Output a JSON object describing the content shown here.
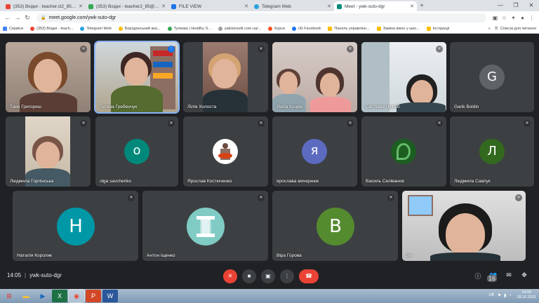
{
  "browser": {
    "tabs": [
      {
        "title": "(353) Вхідні - teacher.cl2_85@ukr",
        "favicon_color": "#4285f4"
      },
      {
        "title": "(353) Вхідні - teacher2_85@ukr",
        "favicon_color": "#34a853"
      },
      {
        "title": "FILE VIEW",
        "favicon_color": "#1a73e8"
      },
      {
        "title": "Telegram Web",
        "favicon_color": "#2aa3e0"
      },
      {
        "title": "Meet - ywk-suto-dgr",
        "favicon_color": "#00897b"
      }
    ],
    "url": "meet.google.com/ywk-suto-dgr",
    "bookmarks": [
      {
        "label": "Сервіси",
        "color": "#4285f4"
      },
      {
        "label": "(353) Вхідні - teach...",
        "color": "#ea4335"
      },
      {
        "label": "Telegram Web",
        "color": "#2aa3e0"
      },
      {
        "label": "Бородянський ака...",
        "color": "#fbbc05"
      },
      {
        "label": "Тулкова | Healthy S...",
        "color": "#34a853"
      },
      {
        "label": "yakistosviti.com.ua/...",
        "color": "#9e9e9e"
      },
      {
        "label": "Курси",
        "color": "#f4511e"
      },
      {
        "label": "(4) Facebook",
        "color": "#1877f2"
      },
      {
        "label": "Панель управлінн...",
        "color": "#fbbc05"
      },
      {
        "label": "Заміна вікон у шко...",
        "color": "#fbbc05"
      },
      {
        "label": "Інструкції",
        "color": "#fbbc05"
      }
    ],
    "reading_list": "Список для читання"
  },
  "participants": [
    {
      "name": "Таня Григориш",
      "type": "video"
    },
    {
      "name": "Тетяна Гребенчук",
      "type": "video"
    },
    {
      "name": "Лілія Холоста",
      "type": "video"
    },
    {
      "name": "Люба Коцюк",
      "type": "video"
    },
    {
      "name": "Світлана Чухліб",
      "type": "video"
    },
    {
      "name": "Garik Boldin",
      "type": "avatar",
      "initial": "G",
      "color": "#5f6368"
    },
    {
      "name": "Людмила Горпінська",
      "type": "video"
    },
    {
      "name": "olga savchenko",
      "type": "avatar",
      "initial": "o",
      "color": "#00897b"
    },
    {
      "name": "Ярослав Костюченко",
      "type": "image"
    },
    {
      "name": "ярослава мочернюк",
      "type": "avatar",
      "initial": "я",
      "color": "#5c6bc0"
    },
    {
      "name": "Василь Селіванов",
      "type": "image"
    },
    {
      "name": "Людмила Савлук",
      "type": "avatar",
      "initial": "Л",
      "color": "#33691e"
    },
    {
      "name": "Наталія Королик",
      "type": "avatar",
      "initial": "H",
      "color": "#0097a7"
    },
    {
      "name": "Антон Іщенко",
      "type": "image"
    },
    {
      "name": "Віра Горова",
      "type": "avatar",
      "initial": "B",
      "color": "#558b2f"
    },
    {
      "name": "Ви",
      "type": "video"
    }
  ],
  "meeting": {
    "time": "14:05",
    "separator": "|",
    "code": "ywk-suto-dgr",
    "participant_count": "16"
  },
  "taskbar": {
    "lang": "UK",
    "time": "14:05",
    "date": "28.10.2021"
  }
}
